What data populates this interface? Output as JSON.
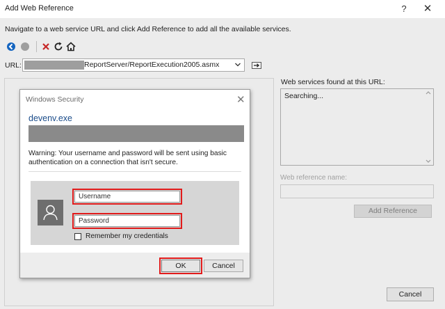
{
  "window": {
    "title": "Add Web Reference",
    "help_glyph": "?",
    "close_glyph": "✕"
  },
  "instructions": "Navigate to a web service URL and click Add Reference to add all the available services.",
  "toolbar": {
    "icons": [
      "back-icon",
      "stop-icon",
      "cancel-icon",
      "refresh-icon",
      "home-icon"
    ]
  },
  "url": {
    "label": "URL:",
    "value_suffix": "ReportServer/ReportExecution2005.asmx"
  },
  "services": {
    "label": "Web services found at this URL:",
    "status": "Searching..."
  },
  "reference": {
    "label": "Web reference name:",
    "value": "",
    "add_button": "Add Reference"
  },
  "main_cancel": "Cancel",
  "security_dialog": {
    "title": "Windows Security",
    "close_glyph": "✕",
    "app_name": "devenv.exe",
    "warning": "Warning: Your username and password will be sent using basic authentication on a connection that isn't secure.",
    "username_placeholder": "Username",
    "password_placeholder": "Password",
    "remember_label": "Remember my credentials",
    "ok_label": "OK",
    "cancel_label": "Cancel"
  },
  "colors": {
    "highlight": "#e11b1b",
    "app_name": "#1b4c8a",
    "back_icon": "#1565c0",
    "cancel_icon": "#c62828"
  }
}
